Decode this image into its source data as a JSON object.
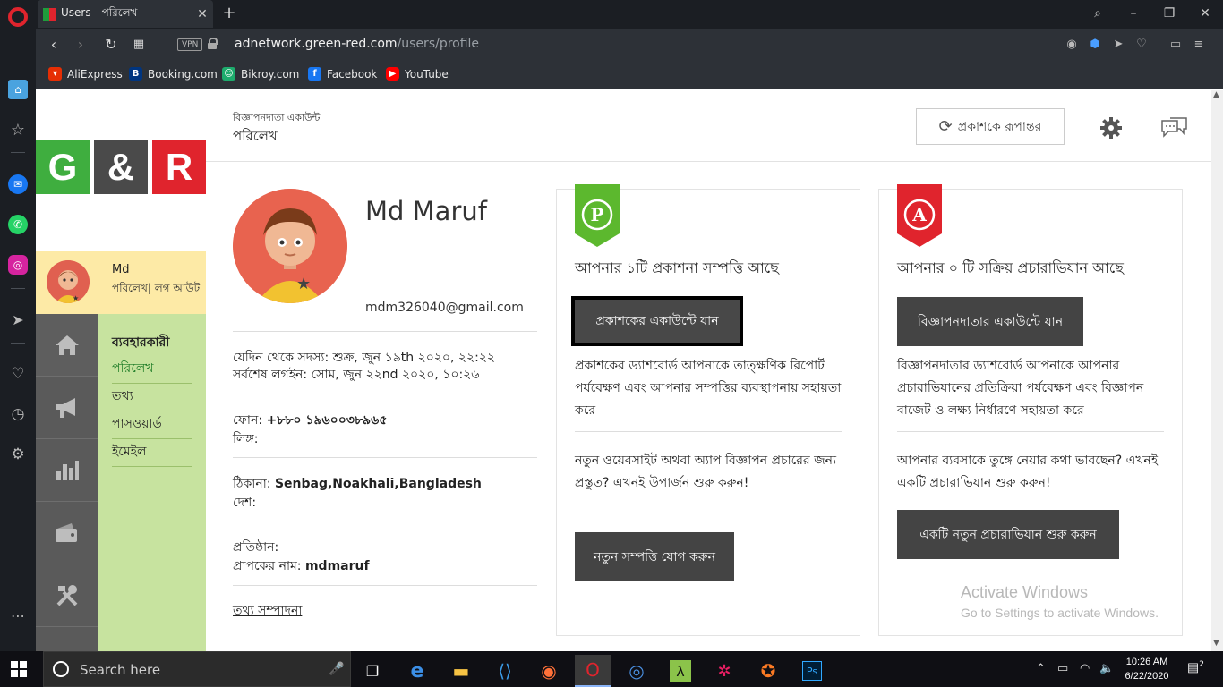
{
  "browser": {
    "tab_title": "Users - পরিলেখ",
    "url_domain": "adnetwork.green-red.com",
    "url_path": "/users/profile",
    "vpn_label": "VPN",
    "bookmarks": [
      "AliExpress",
      "Booking.com",
      "Bikroy.com",
      "Facebook",
      "YouTube"
    ]
  },
  "logo": {
    "left": "G",
    "mid": "&",
    "right": "R"
  },
  "sidebar": {
    "user_name": "Md",
    "profile_link": "পরিলেখ",
    "separator": "|",
    "logout_link": "লগ আউট",
    "menu_heading": "ব্যবহারকারী",
    "menu_items": [
      "পরিলেখ",
      "তথ্য",
      "পাসওয়ার্ড",
      "ইমেইল"
    ]
  },
  "header": {
    "subtitle": "বিজ্ঞাপনদাতা একাউন্ট",
    "title": "পরিলেখ",
    "switch_button": "প্রকাশকে রূপান্তর"
  },
  "profile": {
    "name": "Md Maruf",
    "email": "mdm326040@gmail.com",
    "member_since_label": "যেদিন থেকে সদস্য:",
    "member_since_value": "শুক্র, জুন ১৯th ২০২০, ২২:২২",
    "last_login_label": "সর্বশেষ লগইন:",
    "last_login_value": "সোম, জুন ২২nd ২০২০, ১০:২৬",
    "phone_label": "ফোন:",
    "phone_value": "+৮৮০ ১৯৬০০৩৮৯৬৫",
    "gender_label": "লিঙ্গ:",
    "address_label": "ঠিকানা:",
    "address_value": "Senbag,Noakhali,Bangladesh",
    "country_label": "দেশ:",
    "org_label": "প্রতিষ্ঠান:",
    "payee_label": "প্রাপকের নাম:",
    "payee_value": "mdmaruf",
    "edit_link": "তথ্য সম্পাদনা"
  },
  "publisher_card": {
    "badge_letter": "P",
    "title": "আপনার ১টি প্রকাশনা সম্পত্তি আছে",
    "button": "প্রকাশকের একাউন্টে যান",
    "description": "প্রকাশকের ড্যাশবোর্ড আপনাকে তাত্ক্ষণিক রিপোর্ট পর্যবেক্ষণ এবং আপনার সম্পত্তির ব্যবস্থাপনায় সহায়তা করে",
    "promo": "নতুন ওয়েবসাইট অথবা অ্যাপ বিজ্ঞাপন প্রচারের জন্য প্রস্তুত? এখনই উপার্জন শুরু করুন!",
    "cta": "নতুন সম্পত্তি যোগ করুন",
    "color": "#5cb82e"
  },
  "advertiser_card": {
    "badge_letter": "A",
    "title": "আপনার ০ টি সক্রিয় প্রচারাভিযান আছে",
    "button": "বিজ্ঞাপনদাতার একাউন্টে যান",
    "description": "বিজ্ঞাপনদাতার ড্যাশবোর্ড আপনাকে আপনার প্রচারাভিযানের প্রতিক্রিয়া পর্যবেক্ষণ এবং বিজ্ঞাপন বাজেট ও লক্ষ্য নির্ধারণে সহায়তা করে",
    "promo": "আপনার ব্যবসাকে তুঙ্গে নেয়ার কথা ভাবছেন? এখনই একটি প্রচারাভিযান শুরু করুন!",
    "cta": "একটি নতুন প্রচারাভিযান শুরু করুন",
    "color": "#e0242d"
  },
  "watermark": {
    "line1": "Activate Windows",
    "line2": "Go to Settings to activate Windows."
  },
  "taskbar": {
    "search_placeholder": "Search here",
    "time": "10:26 AM",
    "date": "6/22/2020",
    "notifications": "2"
  }
}
